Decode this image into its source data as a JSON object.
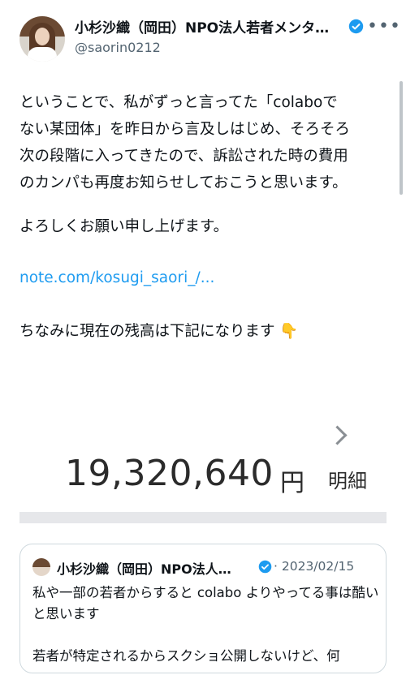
{
  "author": {
    "display_name": "小杉沙織（岡田）NPO法人若者メンタ…",
    "handle": "@saorin0212"
  },
  "tweet": {
    "body_lines": [
      "ということで、私がずっと言ってた「colaboで",
      "ない某団体」を昨日から言及しはじめ、そろそろ",
      "次の段階に入ってきたので、訴訟された時の費用",
      "のカンパも再度お知らせしておこうと思います。"
    ],
    "line2": "よろしくお願い申し上げます。",
    "link": "note.com/kosugi_saori_/...",
    "line3": "ちなみに現在の残高は下記になります 👇"
  },
  "media": {
    "balance": "19,320,640",
    "unit": "円",
    "detail_label": "明細"
  },
  "quote": {
    "display_name": "小杉沙織（岡田）NPO法人…",
    "date": "· 2023/02/15",
    "text_1": "私や一部の若者からすると colabo よりやってる事は酷いと思います",
    "text_2": "若者が特定されるからスクショ公開しないけど、何"
  },
  "colors": {
    "link": "#1d9bf0",
    "verified": "#1d9bf0",
    "muted": "#536471"
  },
  "icons": [
    "verified-badge-icon",
    "more-options-icon",
    "chevron-right-icon",
    "pointing-down-emoji"
  ]
}
